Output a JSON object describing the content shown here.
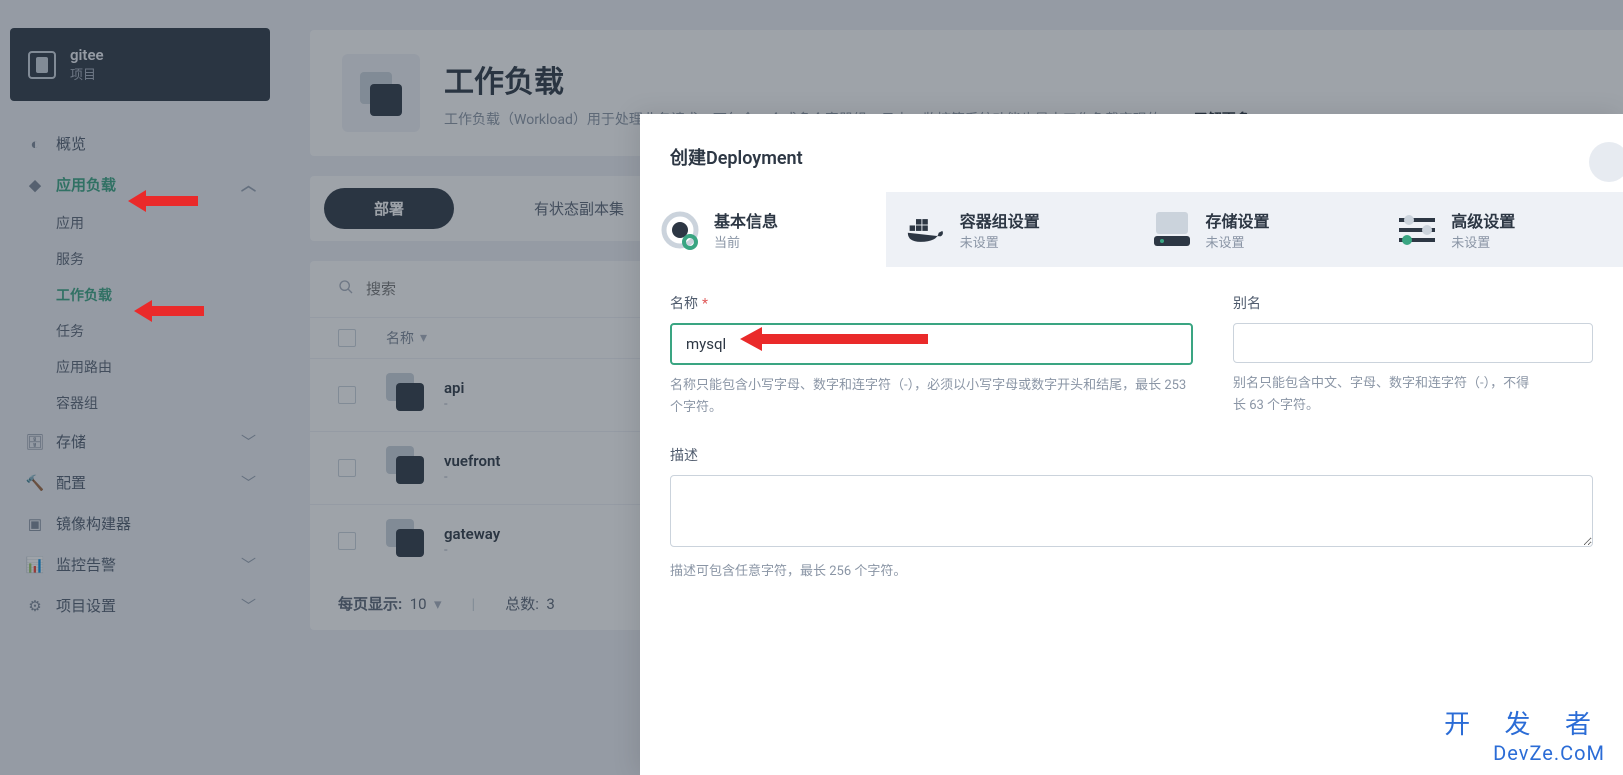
{
  "project": {
    "name": "gitee",
    "sub": "项目"
  },
  "nav": {
    "overview": "概览",
    "appload": "应用负载",
    "sub": {
      "app": "应用",
      "service": "服务",
      "workload": "工作负载",
      "task": "任务",
      "route": "应用路由",
      "podgroup": "容器组"
    },
    "storage": "存储",
    "config": "配置",
    "builder": "镜像构建器",
    "monitor": "监控告警",
    "settings": "项目设置"
  },
  "page": {
    "title": "工作负载",
    "desc": "工作负载（Workload）用于处理业务请求，可包含一个或多个容器组。日志、监控等系统功能也是由工作负载实现的。",
    "learn_more": "了解更多"
  },
  "tabs": {
    "deploy": "部署",
    "stateful": "有状态副本集"
  },
  "search": {
    "placeholder": "搜索"
  },
  "table": {
    "col_name": "名称",
    "rows": [
      {
        "name": "api",
        "sub": "-"
      },
      {
        "name": "vuefront",
        "sub": "-"
      },
      {
        "name": "gateway",
        "sub": "-"
      }
    ]
  },
  "pager": {
    "per_page_label": "每页显示:",
    "per_page": "10",
    "total_label": "总数:",
    "total": "3"
  },
  "modal": {
    "title": "创建Deployment",
    "steps": {
      "basic": {
        "t": "基本信息",
        "s": "当前"
      },
      "pod": {
        "t": "容器组设置",
        "s": "未设置"
      },
      "storage": {
        "t": "存储设置",
        "s": "未设置"
      },
      "advanced": {
        "t": "高级设置",
        "s": "未设置"
      }
    },
    "form": {
      "name_label": "名称",
      "name_value": "mysql",
      "name_hint": "名称只能包含小写字母、数字和连字符（-），必须以小写字母或数字开头和结尾，最长 253 个字符。",
      "alias_label": "别名",
      "alias_hint": "别名只能包含中文、字母、数字和连字符（-），不得",
      "alias_hint2": "长 63 个字符。",
      "desc_label": "描述",
      "desc_hint": "描述可包含任意字符，最长 256 个字符。"
    }
  },
  "watermark": {
    "l1": "开 发 者",
    "l2": "DevZe.CoM"
  }
}
